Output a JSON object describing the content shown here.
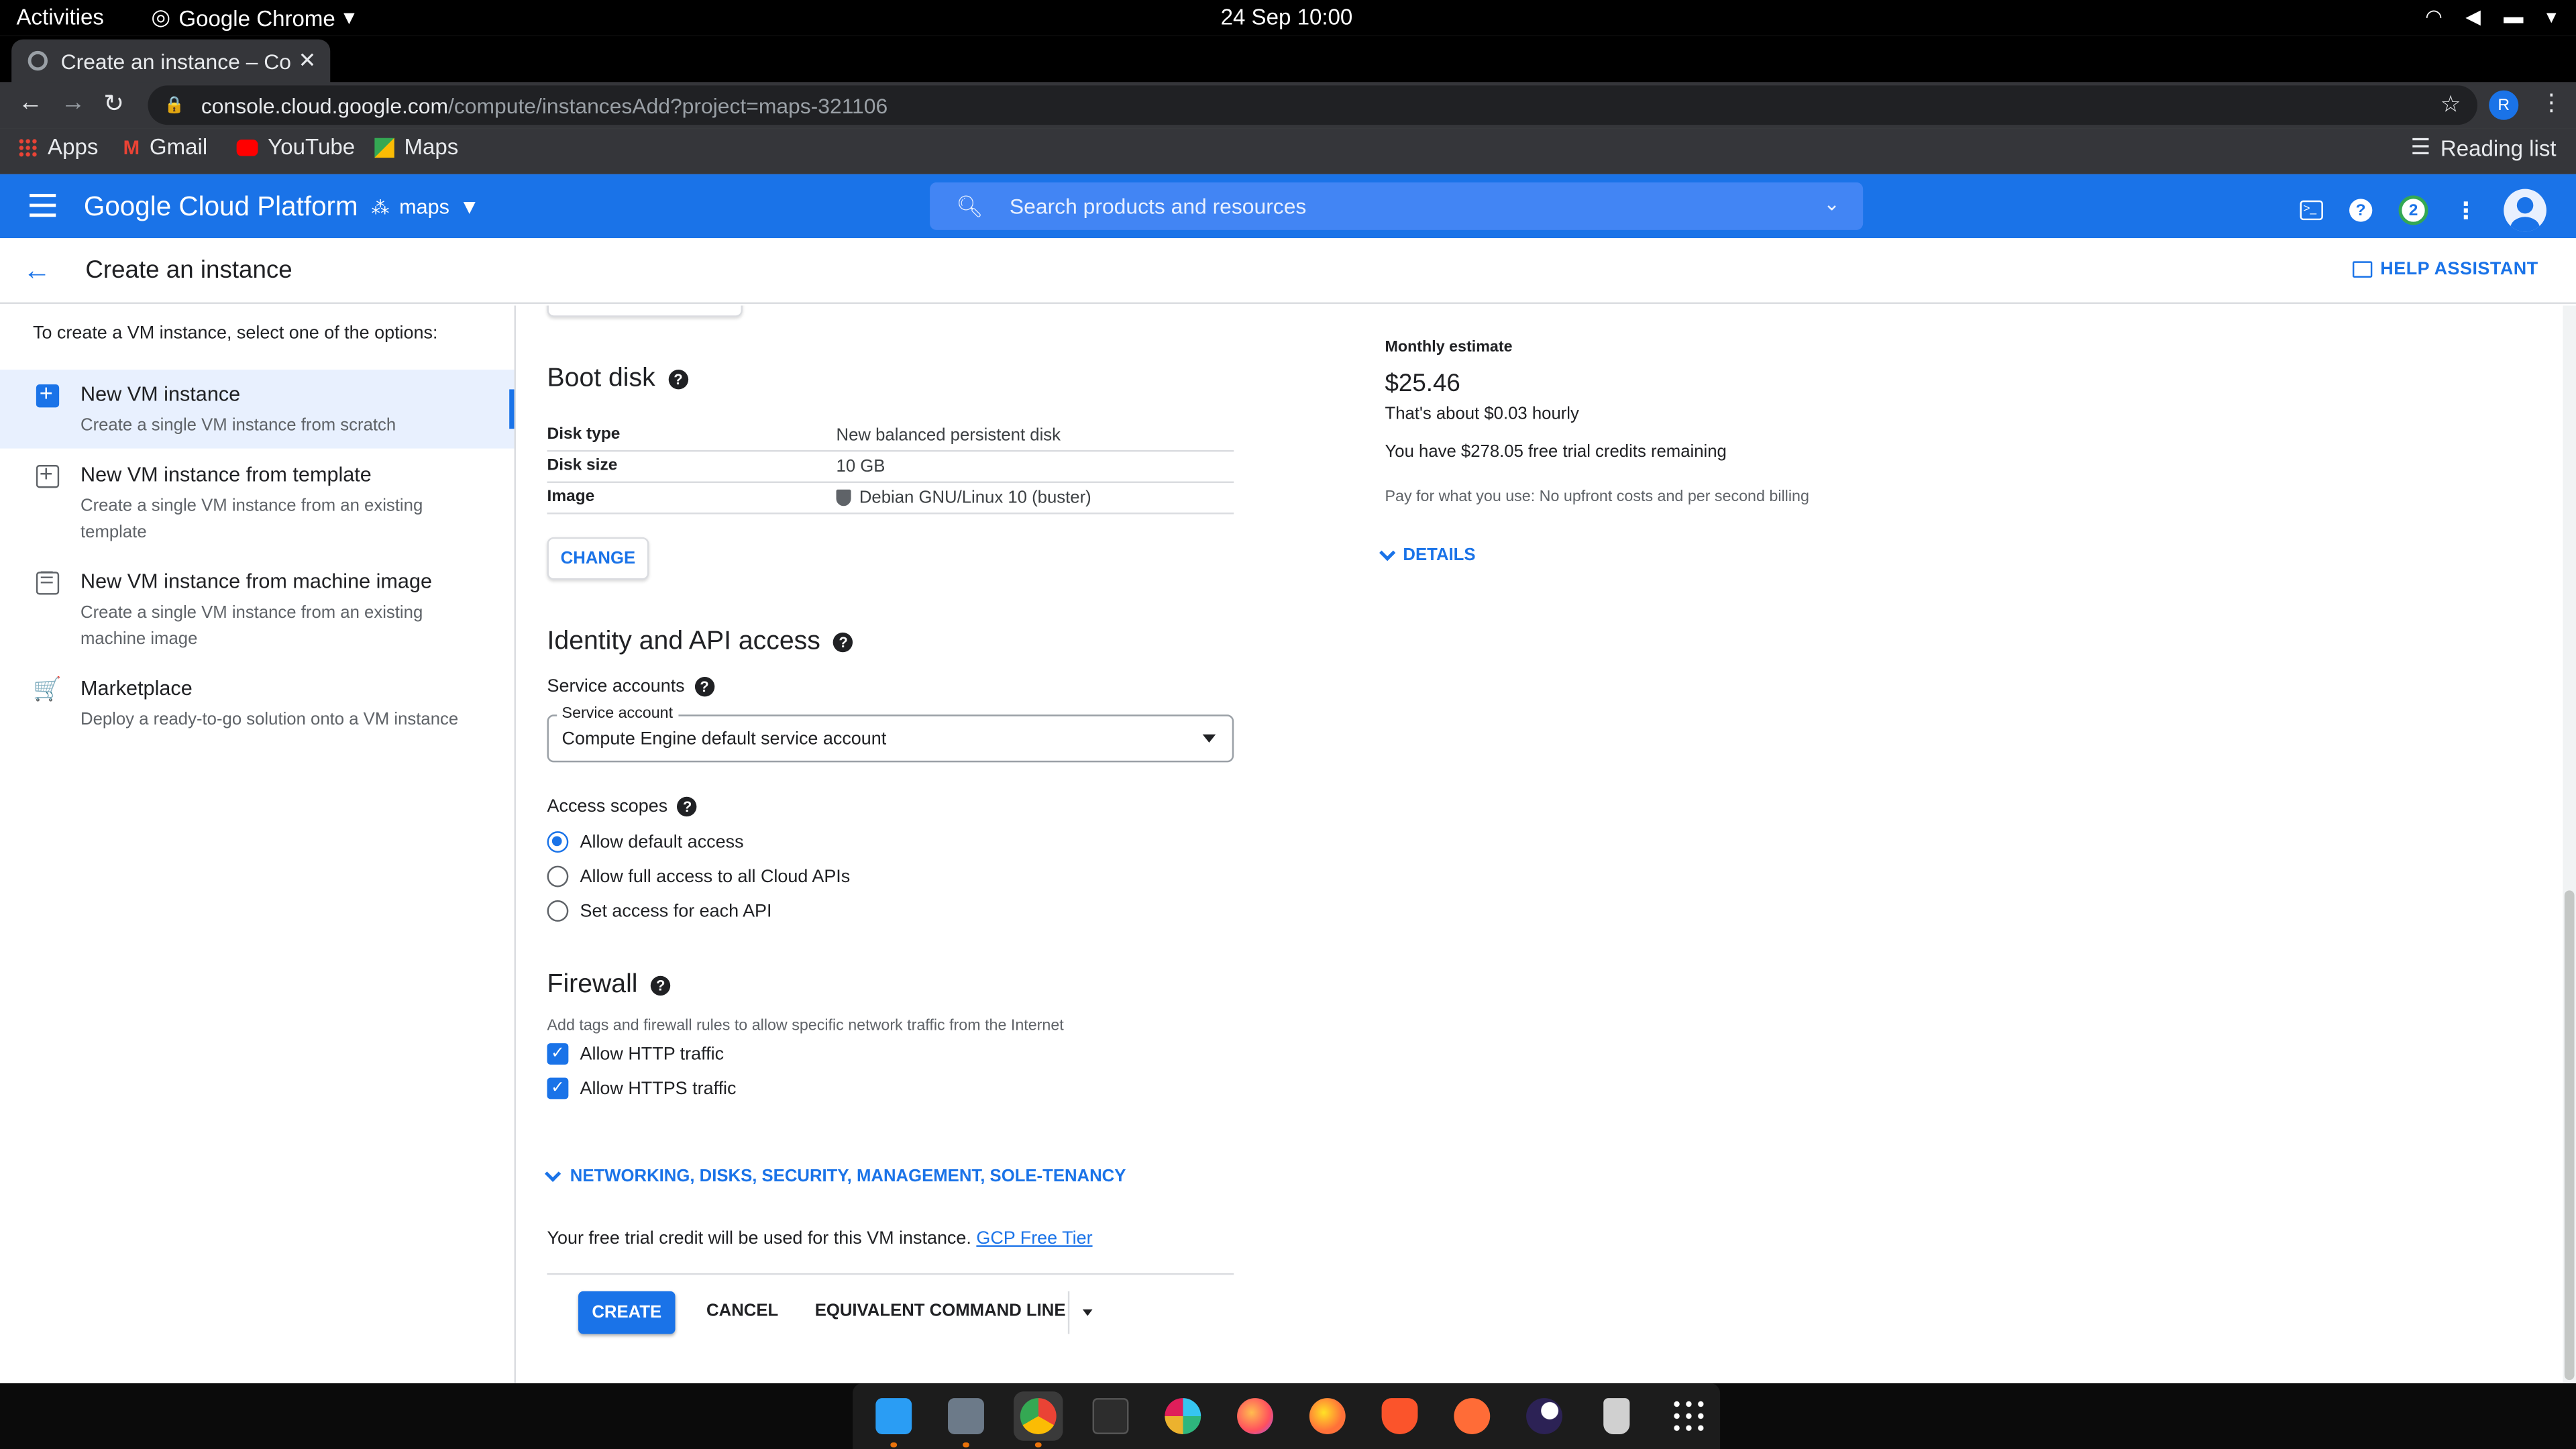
{
  "system": {
    "activities": "Activities",
    "app_name": "Google Chrome",
    "clock": "24 Sep  10:00"
  },
  "browser": {
    "tab_title": "Create an instance – Co",
    "url_host": "console.cloud.google.com",
    "url_path": "/compute/instancesAdd?project=maps-321106",
    "profile_initial": "R",
    "bookmarks": [
      "Apps",
      "Gmail",
      "YouTube",
      "Maps"
    ],
    "reading_list": "Reading list"
  },
  "gcp": {
    "product_title": "Google Cloud Platform",
    "project": "maps",
    "search_placeholder": "Search products and resources",
    "notifications": "2"
  },
  "page": {
    "title": "Create an instance",
    "help_assistant": "HELP ASSISTANT"
  },
  "left": {
    "intro": "To create a VM instance, select one of the options:",
    "options": [
      {
        "title": "New VM instance",
        "desc": "Create a single VM instance from scratch"
      },
      {
        "title": "New VM instance from template",
        "desc": "Create a single VM instance from an existing template"
      },
      {
        "title": "New VM instance from machine image",
        "desc": "Create a single VM instance from an existing machine image"
      },
      {
        "title": "Marketplace",
        "desc": "Deploy a ready-to-go solution onto a VM instance"
      }
    ]
  },
  "boot_disk": {
    "title": "Boot disk",
    "rows": [
      {
        "key": "Disk type",
        "value": "New balanced persistent disk"
      },
      {
        "key": "Disk size",
        "value": "10 GB"
      },
      {
        "key": "Image",
        "value": "Debian GNU/Linux 10 (buster)"
      }
    ],
    "change_label": "CHANGE"
  },
  "identity": {
    "title": "Identity and API access",
    "service_accounts_label": "Service accounts",
    "service_account_float": "Service account",
    "service_account_value": "Compute Engine default service account",
    "access_scopes_label": "Access scopes",
    "scopes": [
      "Allow default access",
      "Allow full access to all Cloud APIs",
      "Set access for each API"
    ]
  },
  "firewall": {
    "title": "Firewall",
    "help": "Add tags and firewall rules to allow specific network traffic from the Internet",
    "options": [
      "Allow HTTP traffic",
      "Allow HTTPS traffic"
    ]
  },
  "footer": {
    "networking_link": "NETWORKING, DISKS, SECURITY, MANAGEMENT, SOLE-TENANCY",
    "trial_text": "Your free trial credit will be used for this VM instance.",
    "trial_link": "GCP Free Tier",
    "create": "CREATE",
    "cancel": "CANCEL",
    "equivalent": "EQUIVALENT COMMAND LINE"
  },
  "estimate": {
    "title": "Monthly estimate",
    "price": "$25.46",
    "hourly": "That's about $0.03 hourly",
    "credits": "You have $278.05 free trial credits remaining",
    "payg": "Pay for what you use: No upfront costs and per second billing",
    "details": "DETAILS"
  },
  "dock_apps": [
    "finder-icon",
    "files-icon",
    "chrome-icon",
    "terminal-icon",
    "slack-icon",
    "firefox-icon",
    "firefox-alt-icon",
    "brave-icon",
    "postman-icon",
    "eclipse-icon",
    "trash-icon",
    "app-grid-icon"
  ]
}
